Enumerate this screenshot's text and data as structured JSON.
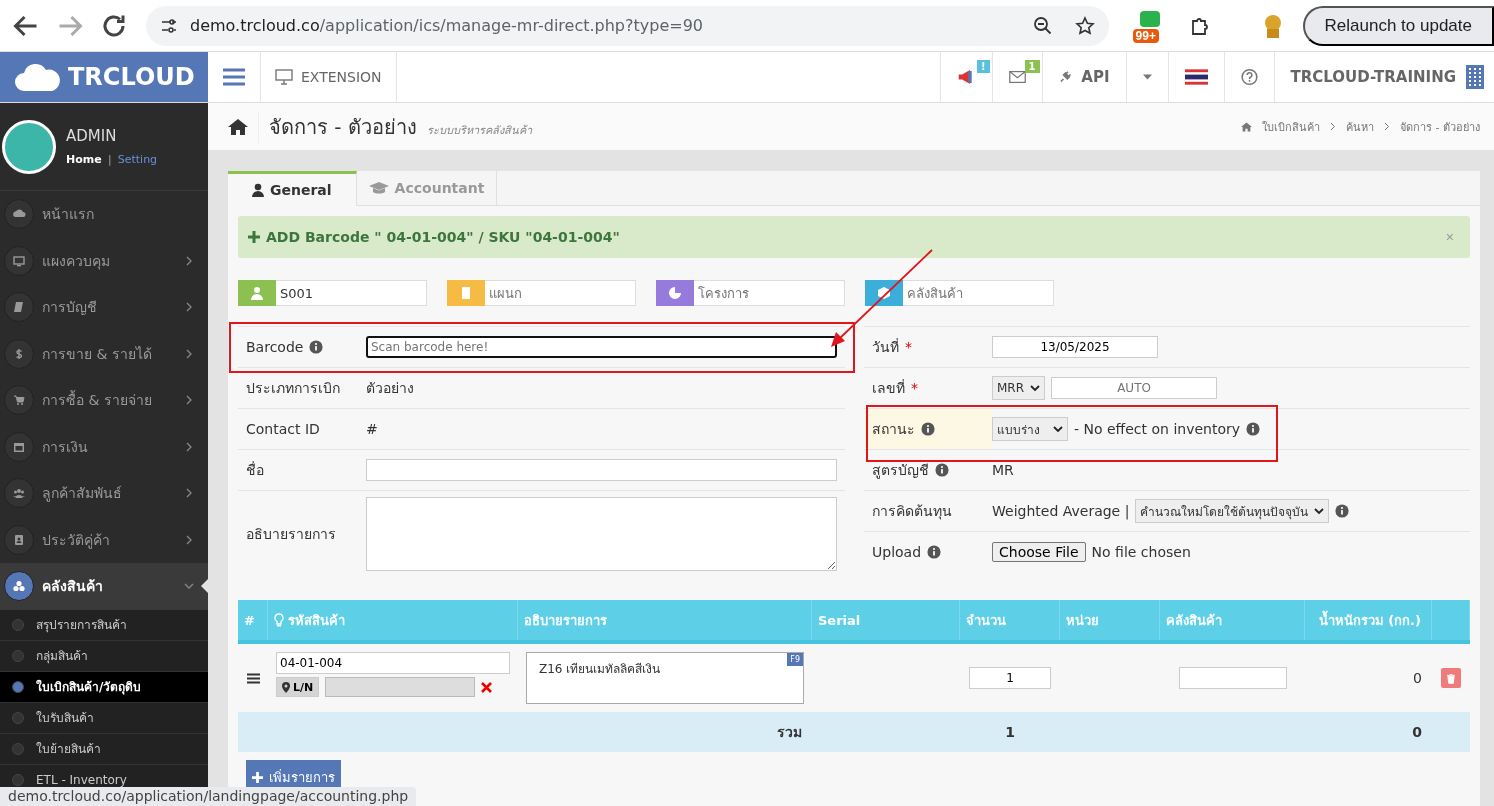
{
  "browser": {
    "url_host": "demo.trcloud.co",
    "url_path": "/application/ics/manage-mr-direct.php?type=90",
    "extension_badge": "99+",
    "relaunch": "Relaunch to update"
  },
  "header": {
    "logo": "TRCLOUD",
    "extension": "EXTENSION",
    "notify_badge": "!",
    "mail_badge": "1",
    "api": "API",
    "company": "TRCLOUD-TRAINING"
  },
  "sidebar": {
    "user": "ADMIN",
    "home": "Home",
    "separator": "|",
    "setting": "Setting",
    "items": [
      {
        "label": "หน้าแรก",
        "has_arrow": false,
        "selected": false,
        "expanded": false
      },
      {
        "label": "แผงควบคุม",
        "has_arrow": true,
        "selected": false,
        "expanded": false
      },
      {
        "label": "การบัญชี",
        "has_arrow": true,
        "selected": false,
        "expanded": false
      },
      {
        "label": "การขาย & รายได้",
        "has_arrow": true,
        "selected": false,
        "expanded": false
      },
      {
        "label": "การซื้อ & รายจ่าย",
        "has_arrow": true,
        "selected": false,
        "expanded": false
      },
      {
        "label": "การเงิน",
        "has_arrow": true,
        "selected": false,
        "expanded": false
      },
      {
        "label": "ลูกค้าสัมพันธ์",
        "has_arrow": true,
        "selected": false,
        "expanded": false
      },
      {
        "label": "ประวัติคู่ค้า",
        "has_arrow": true,
        "selected": false,
        "expanded": false
      },
      {
        "label": "คลังสินค้า",
        "has_arrow": true,
        "selected": true,
        "expanded": true,
        "children": [
          {
            "label": "สรุปรายการสินค้า",
            "selected": false
          },
          {
            "label": "กลุ่มสินค้า",
            "selected": false
          },
          {
            "label": "ใบเบิกสินค้า/วัตถุดิบ",
            "selected": true
          },
          {
            "label": "ใบรับสินค้า",
            "selected": false
          },
          {
            "label": "ใบย้ายสินค้า",
            "selected": false
          },
          {
            "label": "ETL - Inventory",
            "selected": false
          }
        ]
      }
    ]
  },
  "page_header": {
    "title": "จัดการ - ตัวอย่าง",
    "subtitle": "ระบบบริหารคลังสินค้า",
    "breadcrumbs": [
      "ใบเบิกสินค้า",
      "ค้นหา",
      "จัดการ - ตัวอย่าง"
    ]
  },
  "tabs": [
    {
      "label": "General",
      "selected": true
    },
    {
      "label": "Accountant",
      "selected": false
    }
  ],
  "alert": {
    "text": "ADD Barcode \" 04-01-004\" / SKU \"04-01-004\"",
    "close": "×"
  },
  "tag_fields": [
    {
      "value": "S001",
      "color": "#8cc152"
    },
    {
      "placeholder": "แผนก",
      "color": "#f6bb42"
    },
    {
      "placeholder": "โครงการ",
      "color": "#967adc"
    },
    {
      "placeholder": "คลังสินค้า",
      "color": "#3bafda"
    }
  ],
  "left_form": [
    {
      "kind": "input",
      "label": "Barcode",
      "info": true,
      "placeholder": "Scan barcode here!"
    },
    {
      "kind": "text",
      "label": "ประเภทการเบิก",
      "info": false,
      "value": "ตัวอย่าง"
    },
    {
      "kind": "text",
      "label": "Contact ID",
      "info": false,
      "value": "#"
    },
    {
      "kind": "input",
      "label": "ชื่อ",
      "info": false
    },
    {
      "kind": "textarea",
      "label": "อธิบายรายการ",
      "info": false
    }
  ],
  "right_form": [
    {
      "kind": "date",
      "label": "วันที่",
      "required_mark": "*",
      "info": false,
      "highlighted": false,
      "value": "13/05/2025"
    },
    {
      "kind": "number",
      "label": "เลขที่",
      "required_mark": "*",
      "info": false,
      "highlighted": false,
      "prefix": "MRR",
      "placeholder": "AUTO"
    },
    {
      "kind": "status",
      "label": "สถานะ",
      "info": true,
      "highlighted": true,
      "value": "แบบร่าง",
      "note": "- No effect on inventory"
    },
    {
      "kind": "text",
      "label": "สูตรบัญชี",
      "info": true,
      "highlighted": false,
      "value": "MR"
    },
    {
      "kind": "cost",
      "label": "การคิดต้นทุน",
      "info": false,
      "highlighted": false,
      "method": "Weighted Average |",
      "value": "คำนวณใหม่โดยใช้ต้นทุนปัจจุบัน"
    },
    {
      "kind": "upload",
      "label": "Upload",
      "info": true,
      "highlighted": false,
      "button": "Choose File",
      "value": "No file chosen"
    }
  ],
  "table": {
    "columns": [
      "#",
      "รหัสสินค้า",
      "อธิบายรายการ",
      "Serial",
      "จำนวน",
      "หน่วย",
      "คลังสินค้า",
      "น้ำหนักรวม (กก.)"
    ],
    "rows": [
      {
        "code": "04-01-004",
        "lot_label": "L/N",
        "description": "Z16 เทียนเมทัลลิคสีเงิน",
        "desc_key": "F9",
        "qty": "1",
        "weight": "0"
      }
    ],
    "total": {
      "label": "รวม",
      "qty": "1",
      "weight": "0"
    },
    "add_button": "เพิ่มรายการ"
  },
  "status_url": "demo.trcloud.co/application/landingpage/accounting.php"
}
